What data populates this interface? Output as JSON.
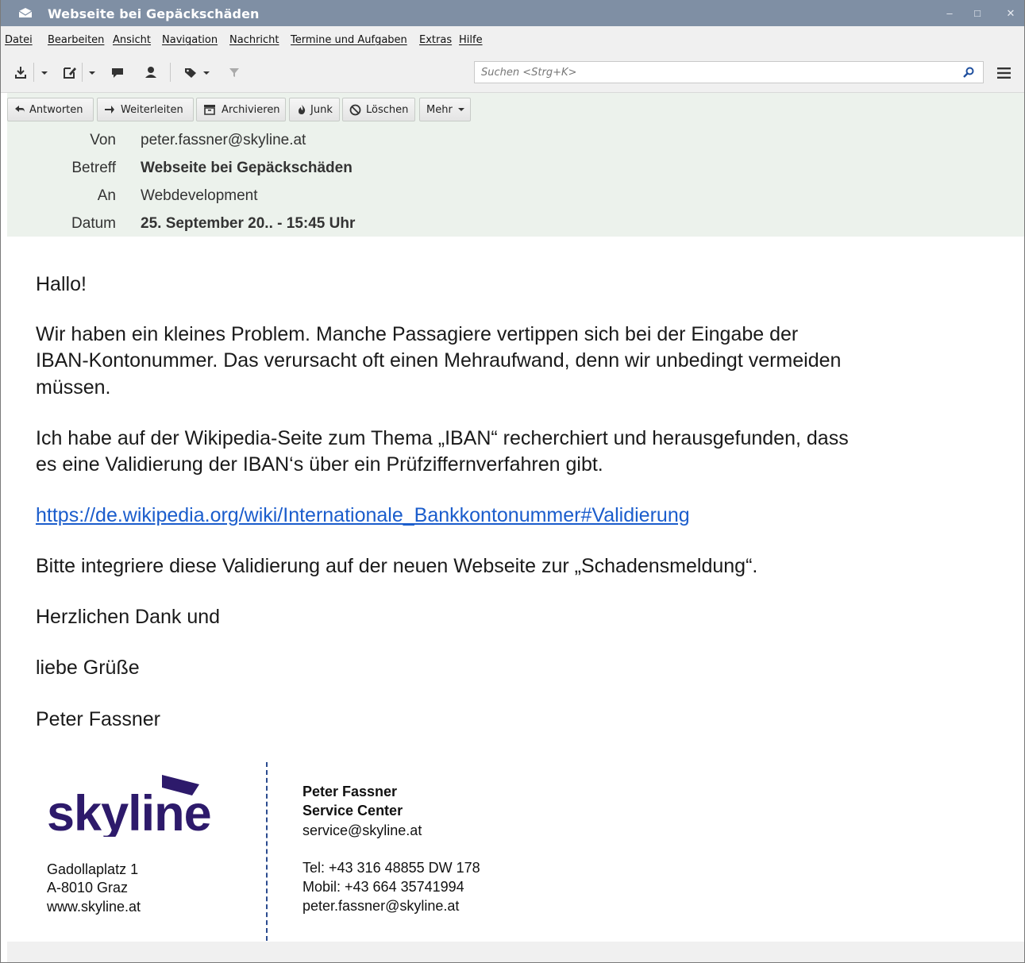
{
  "window": {
    "title": "Webseite bei Gepäckschäden",
    "app_icon": "mail-envelope-icon",
    "controls": [
      "minimize-icon",
      "maximize-icon",
      "close-icon"
    ],
    "minimize_glyph": "–",
    "maximize_glyph": "□",
    "close_glyph": "✕"
  },
  "menu": {
    "items": [
      "Datei",
      "Bearbeiten",
      "Ansicht",
      "Navigation",
      "Nachricht",
      "Termine und Aufgaben",
      "Extras",
      "Hilfe"
    ]
  },
  "toolbar": {
    "icons": [
      "get-messages-icon",
      "dropdown-arrow-icon",
      "write-icon",
      "dropdown-arrow-icon",
      "chat-icon",
      "address-book-icon",
      "tag-icon",
      "dropdown-arrow-icon",
      "filter-icon"
    ],
    "search_placeholder": "Suchen <Strg+K>",
    "menu_icon": "hamburger-menu-icon"
  },
  "message_actions": {
    "reply": "Antworten",
    "forward": "Weiterleiten",
    "archive": "Archivieren",
    "junk": "Junk",
    "delete": "Löschen",
    "more": "Mehr"
  },
  "headers": {
    "from_label": "Von",
    "from_value": "peter.fassner@skyline.at",
    "subject_label": "Betreff",
    "subject_value": "Webseite bei Gepäckschäden",
    "to_label": "An",
    "to_value": "Webdevelopment",
    "date_label": "Datum",
    "date_value": "25. September 20.. - 15:45 Uhr"
  },
  "body": {
    "greeting": "Hallo!",
    "p1_line1": "Wir haben ein kleines Problem. Manche Passagiere vertippen sich bei der Eingabe der",
    "p1_line2": "IBAN-Kontonummer. Das verursacht oft einen Mehraufwand, denn wir unbedingt vermeiden",
    "p1_line3": "müssen.",
    "p2_line1": "Ich habe auf der Wikipedia-Seite zum Thema „IBAN“ recherchiert und herausgefunden, dass",
    "p2_line2": "es eine Validierung der IBAN‘s über ein Prüfziffernverfahren gibt.",
    "link": "https://de.wikipedia.org/wiki/Internationale_Bankkontonummer#Validierung",
    "p3": "Bitte integriere diese Validierung auf der neuen Webseite zur „Schadensmeldung“.",
    "closing1": "Herzlichen Dank und",
    "closing2": "liebe Grüße",
    "name": "Peter Fassner"
  },
  "signature": {
    "logo_text": "skyline",
    "logo_color": "#2d1a6b",
    "address1": "Gadollaplatz 1",
    "address2": "A-8010 Graz",
    "website": "www.skyline.at",
    "name": "Peter Fassner",
    "department": "Service Center",
    "email_service": "service@skyline.at",
    "tel": "Tel: +43 316 48855 DW 178",
    "mobile": "Mobil: +43 664 35741994",
    "email": "peter.fassner@skyline.at"
  },
  "colors": {
    "titlebar": "#7f8fa4",
    "header_bg": "#ecf2ec",
    "link": "#1b5dcc"
  }
}
